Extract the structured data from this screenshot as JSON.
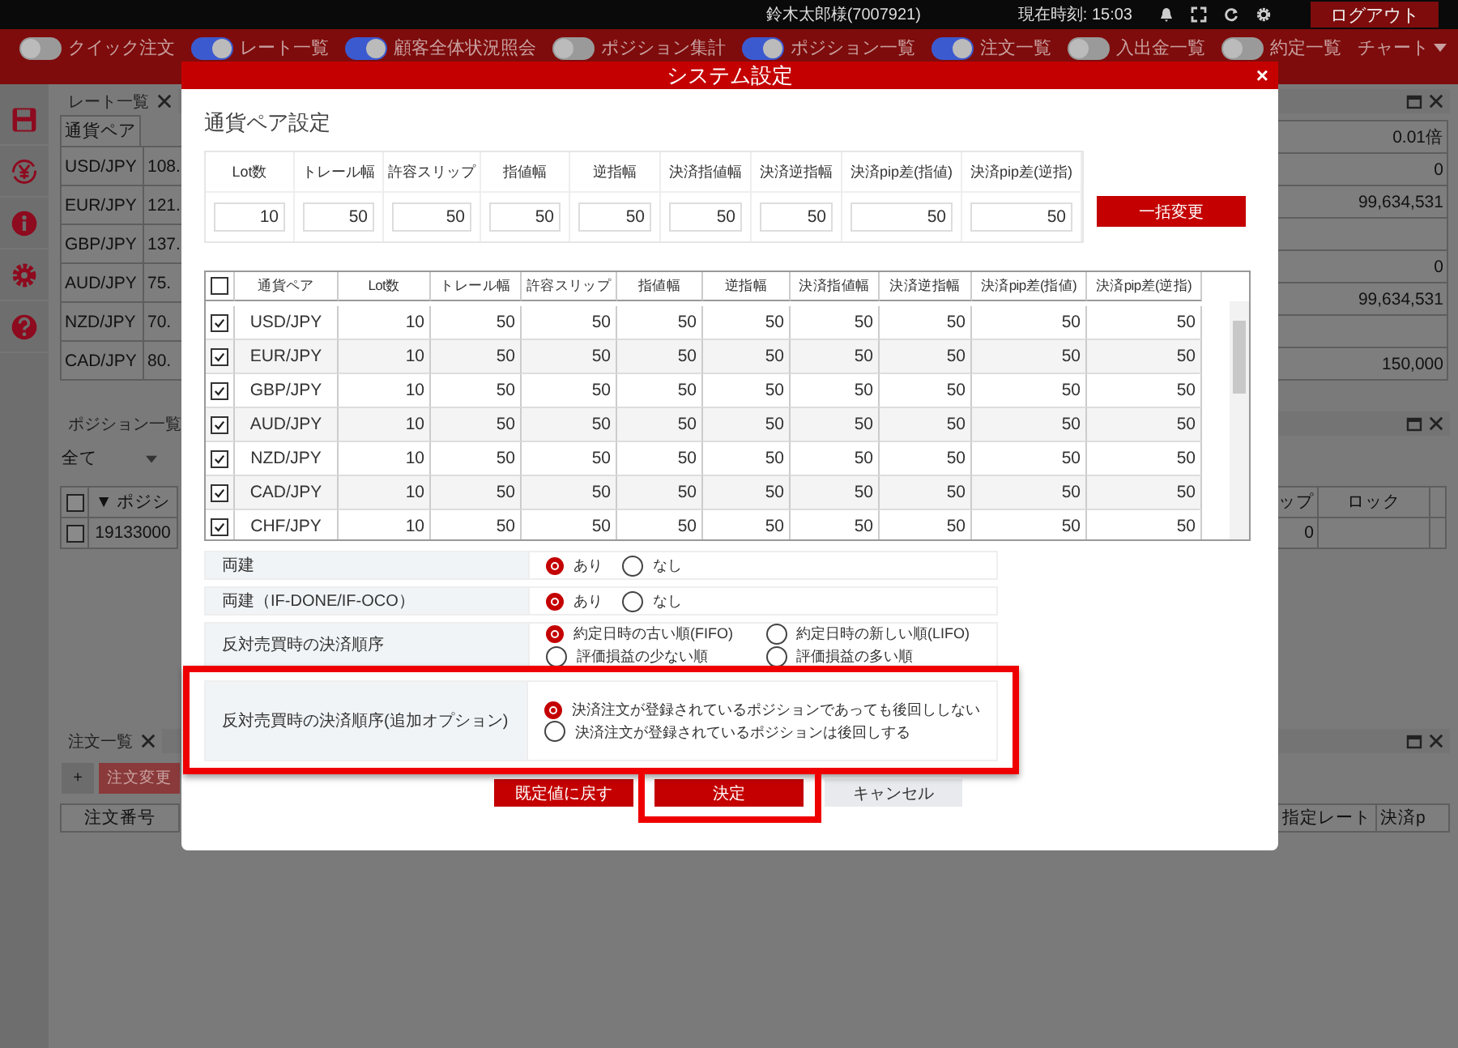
{
  "header": {
    "user": "鈴木太郎様(7007921)",
    "clock": "現在時刻: 15:03",
    "logout": "ログアウト"
  },
  "toolbar": [
    {
      "label": "クイック注文",
      "on": false
    },
    {
      "label": "レート一覧",
      "on": true
    },
    {
      "label": "顧客全体状況照会",
      "on": true
    },
    {
      "label": "ポジション集計",
      "on": false
    },
    {
      "label": "ポジション一覧",
      "on": true
    },
    {
      "label": "注文一覧",
      "on": true
    },
    {
      "label": "入出金一覧",
      "on": false
    },
    {
      "label": "約定一覧",
      "on": false
    }
  ],
  "chart_menu": "チャート",
  "rate_panel": {
    "title": "レート一覧",
    "column": "通貨ペア",
    "rows": [
      {
        "pair": "USD/JPY",
        "rate": "108."
      },
      {
        "pair": "EUR/JPY",
        "rate": "121."
      },
      {
        "pair": "GBP/JPY",
        "rate": "137."
      },
      {
        "pair": "AUD/JPY",
        "rate": "75."
      },
      {
        "pair": "NZD/JPY",
        "rate": "70."
      },
      {
        "pair": "CAD/JPY",
        "rate": "80."
      }
    ],
    "right_values": [
      {
        "kind": "value",
        "value": "0.01倍"
      },
      {
        "kind": "value",
        "value": "0"
      },
      {
        "kind": "value",
        "value": "99,634,531"
      },
      {
        "kind": "empty"
      },
      {
        "kind": "value",
        "value": "0"
      },
      {
        "kind": "value",
        "value": "99,634,531"
      },
      {
        "kind": "empty"
      },
      {
        "kind": "value",
        "value": "150,000"
      }
    ]
  },
  "position_panel": {
    "title": "ポジション一覧",
    "filter": "全て",
    "column": "▼ ポジシ",
    "right_columns": [
      "ップ",
      "ロック"
    ],
    "row": {
      "checked": false,
      "id": "19133000",
      "right_value": "0"
    },
    "header_checked": false
  },
  "order_panel": {
    "title": "注文一覧",
    "add": "+",
    "edit": "注文変更",
    "column": "注文番号",
    "right_columns": [
      "指定レート",
      "決済p"
    ]
  },
  "modal": {
    "title": "システム設定",
    "close": "×",
    "section": "通貨ペア設定",
    "batch": [
      {
        "label": "Lot数",
        "value": "10"
      },
      {
        "label": "トレール幅",
        "value": "50"
      },
      {
        "label": "許容スリップ",
        "value": "50"
      },
      {
        "label": "指値幅",
        "value": "50"
      },
      {
        "label": "逆指幅",
        "value": "50"
      },
      {
        "label": "決済指値幅",
        "value": "50"
      },
      {
        "label": "決済逆指幅",
        "value": "50"
      },
      {
        "label": "決済pip差(指値)",
        "value": "50"
      },
      {
        "label": "決済pip差(逆指)",
        "value": "50"
      }
    ],
    "batch_button": "一括変更",
    "table": {
      "all_checked": false,
      "columns": [
        "通貨ペア",
        "Lot数",
        "トレール幅",
        "許容スリップ",
        "指値幅",
        "逆指幅",
        "決済指値幅",
        "決済逆指幅",
        "決済pip差(指値)",
        "決済pip差(逆指)"
      ],
      "rows": [
        {
          "checked": true,
          "cells": [
            "USD/JPY",
            "10",
            "50",
            "50",
            "50",
            "50",
            "50",
            "50",
            "50",
            "50"
          ]
        },
        {
          "checked": true,
          "cells": [
            "EUR/JPY",
            "10",
            "50",
            "50",
            "50",
            "50",
            "50",
            "50",
            "50",
            "50"
          ]
        },
        {
          "checked": true,
          "cells": [
            "GBP/JPY",
            "10",
            "50",
            "50",
            "50",
            "50",
            "50",
            "50",
            "50",
            "50"
          ]
        },
        {
          "checked": true,
          "cells": [
            "AUD/JPY",
            "10",
            "50",
            "50",
            "50",
            "50",
            "50",
            "50",
            "50",
            "50"
          ]
        },
        {
          "checked": true,
          "cells": [
            "NZD/JPY",
            "10",
            "50",
            "50",
            "50",
            "50",
            "50",
            "50",
            "50",
            "50"
          ]
        },
        {
          "checked": true,
          "cells": [
            "CAD/JPY",
            "10",
            "50",
            "50",
            "50",
            "50",
            "50",
            "50",
            "50",
            "50"
          ]
        },
        {
          "checked": true,
          "cells": [
            "CHF/JPY",
            "10",
            "50",
            "50",
            "50",
            "50",
            "50",
            "50",
            "50",
            "50"
          ]
        }
      ]
    },
    "options": [
      {
        "label": "両建",
        "choices": [
          {
            "label": "あり",
            "selected": true
          },
          {
            "label": "なし",
            "selected": false
          }
        ]
      },
      {
        "label": "両建（IF-DONE/IF-OCO）",
        "choices": [
          {
            "label": "あり",
            "selected": true
          },
          {
            "label": "なし",
            "selected": false
          }
        ]
      },
      {
        "label": "反対売買時の決済順序",
        "choices": [
          {
            "label": "約定日時の古い順(FIFO)",
            "selected": true
          },
          {
            "label": "約定日時の新しい順(LIFO)",
            "selected": false
          },
          {
            "label": "評価損益の少ない順",
            "selected": false
          },
          {
            "label": "評価損益の多い順",
            "selected": false
          }
        ]
      },
      {
        "label": "反対売買時の決済順序(追加オプション)",
        "choices": [
          {
            "label": "決済注文が登録されているポジションであっても後回ししない",
            "selected": true
          },
          {
            "label": "決済注文が登録されているポジションは後回しする",
            "selected": false
          }
        ]
      }
    ],
    "buttons": [
      {
        "label": "既定値に戻す",
        "kind": "reset"
      },
      {
        "label": "決定",
        "kind": "primary"
      },
      {
        "label": "キャンセル",
        "kind": "cancel"
      }
    ]
  }
}
